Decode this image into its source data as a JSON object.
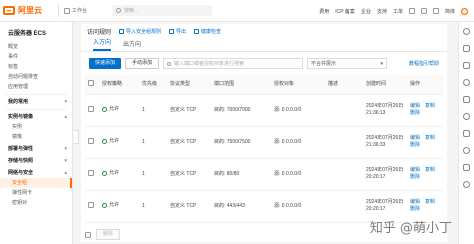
{
  "brand": {
    "name": "阿里云",
    "accent": "#ff6a00",
    "link_color": "#0070cc"
  },
  "topbar": {
    "workbench": "工作台",
    "search_placeholder": "搜索...",
    "nav": [
      "费用",
      "ICP 备案",
      "企业",
      "支持",
      "工单"
    ],
    "lang": "简体"
  },
  "sidebar": {
    "title": "云服务器 ECS",
    "items": [
      {
        "label": "概览",
        "type": "item"
      },
      {
        "label": "事件",
        "type": "item"
      },
      {
        "label": "标签",
        "type": "item"
      },
      {
        "label": "自动问题排查",
        "type": "item"
      },
      {
        "label": "应用管理",
        "type": "item"
      },
      {
        "label": "我的常用",
        "type": "group"
      },
      {
        "label": "实例与镜像",
        "type": "group"
      },
      {
        "label": "实例",
        "type": "sub"
      },
      {
        "label": "镜像",
        "type": "sub"
      },
      {
        "label": "部署与弹性",
        "type": "group"
      },
      {
        "label": "存储与快照",
        "type": "group"
      },
      {
        "label": "网络与安全",
        "type": "group"
      },
      {
        "label": "安全组",
        "type": "sub-active"
      },
      {
        "label": "弹性网卡",
        "type": "sub"
      },
      {
        "label": "密钥对",
        "type": "sub"
      }
    ]
  },
  "rules": {
    "title": "访问规则",
    "actions": [
      "导入安全组规则",
      "导出",
      "健康检查"
    ],
    "tabs": [
      "入方向",
      "出方向"
    ],
    "toolbar": {
      "quick_add": "快速添加",
      "manual_add": "手动添加",
      "filter_placeholder": "输入端口或者授权对象进行搜索",
      "select_value": "不合并展示",
      "guide_link": "教程指引帮助"
    },
    "columns": [
      "授权策略",
      "优先级",
      "协议类型",
      "端口范围",
      "授权对象",
      "描述",
      "创建时间",
      "操作"
    ],
    "rows": [
      {
        "policy": "允许",
        "priority": "1",
        "protocol": "自定义 TCP",
        "port": "目的: 7000/7000",
        "source": "源: 0.0.0.0/0",
        "desc": "",
        "time": "2024年07月26日 21:36:13",
        "ops": [
          "编辑",
          "复制",
          "删除"
        ]
      },
      {
        "policy": "允许",
        "priority": "1",
        "protocol": "自定义 TCP",
        "port": "目的: 7500/7500",
        "source": "源: 0.0.0.0/0",
        "desc": "",
        "time": "2024年07月26日 21:36:33",
        "ops": [
          "编辑",
          "复制",
          "删除"
        ]
      },
      {
        "policy": "允许",
        "priority": "1",
        "protocol": "自定义 TCP",
        "port": "目的: 80/80",
        "source": "源: 0.0.0.0/0",
        "desc": "",
        "time": "2024年07月26日 20:20:17",
        "ops": [
          "编辑",
          "复制",
          "删除"
        ]
      },
      {
        "policy": "允许",
        "priority": "1",
        "protocol": "自定义 TCP",
        "port": "目的: 443/443",
        "source": "源: 0.0.0.0/0",
        "desc": "",
        "time": "2024年07月26日 20:20:17",
        "ops": [
          "编辑",
          "复制",
          "删除"
        ]
      }
    ],
    "footer": {
      "delete": "删除"
    }
  },
  "watermark": "知乎 @萌小丁"
}
